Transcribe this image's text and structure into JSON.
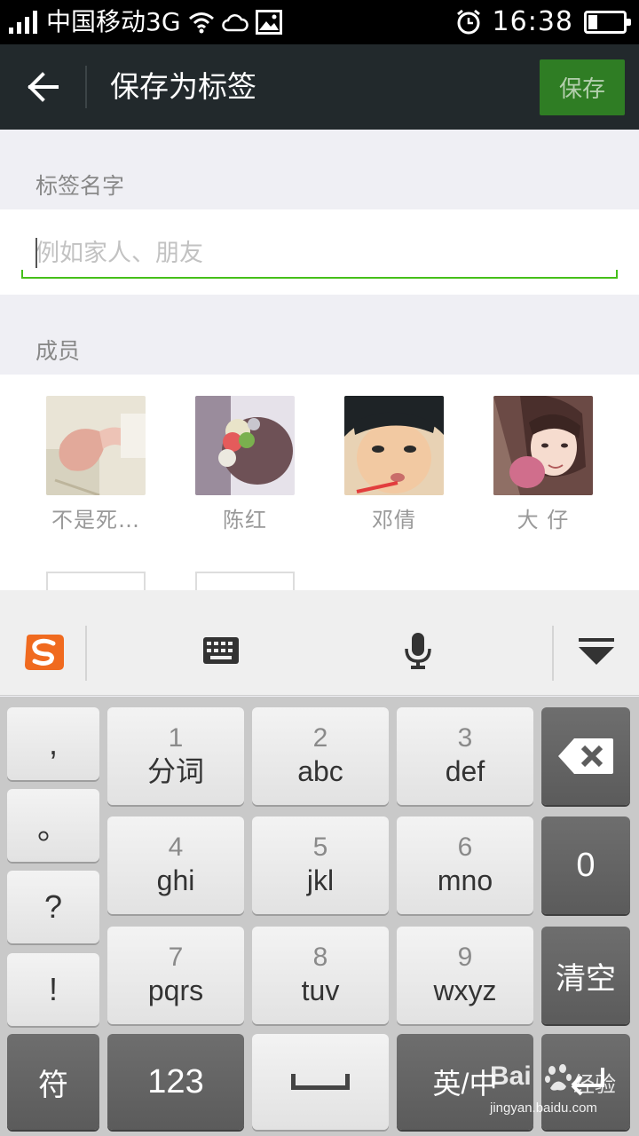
{
  "status_bar": {
    "carrier": "中国移动3G",
    "time": "16:38",
    "battery_level": 0.25,
    "icons": [
      "signal-icon",
      "wifi-icon",
      "cloud-icon",
      "image-icon",
      "alarm-icon",
      "battery-icon"
    ]
  },
  "header": {
    "title": "保存为标签",
    "save_label": "保存"
  },
  "tag_name": {
    "label": "标签名字",
    "placeholder": "例如家人、朋友",
    "value": ""
  },
  "members": {
    "label": "成员",
    "items": [
      {
        "name": "不是死…"
      },
      {
        "name": "陈红"
      },
      {
        "name": "邓倩"
      },
      {
        "name": "大 仔"
      }
    ]
  },
  "keyboard": {
    "punct": [
      ",",
      "。",
      "?",
      "!"
    ],
    "keys": [
      {
        "num": "1",
        "letters": "分词"
      },
      {
        "num": "2",
        "letters": "abc"
      },
      {
        "num": "3",
        "letters": "def"
      },
      {
        "num": "4",
        "letters": "ghi"
      },
      {
        "num": "5",
        "letters": "jkl"
      },
      {
        "num": "6",
        "letters": "mno"
      },
      {
        "num": "7",
        "letters": "pqrs"
      },
      {
        "num": "8",
        "letters": "tuv"
      },
      {
        "num": "9",
        "letters": "wxyz"
      }
    ],
    "zero": "0",
    "clear": "清空",
    "symbols": "符",
    "numbers": "123",
    "lang": "英/中"
  },
  "watermark": {
    "brand": "Bai",
    "brand2": "经验",
    "url": "jingyan.baidu.com"
  },
  "colors": {
    "header_bg": "#22292c",
    "accent_green": "#2f7d24",
    "input_underline": "#45c01a"
  }
}
